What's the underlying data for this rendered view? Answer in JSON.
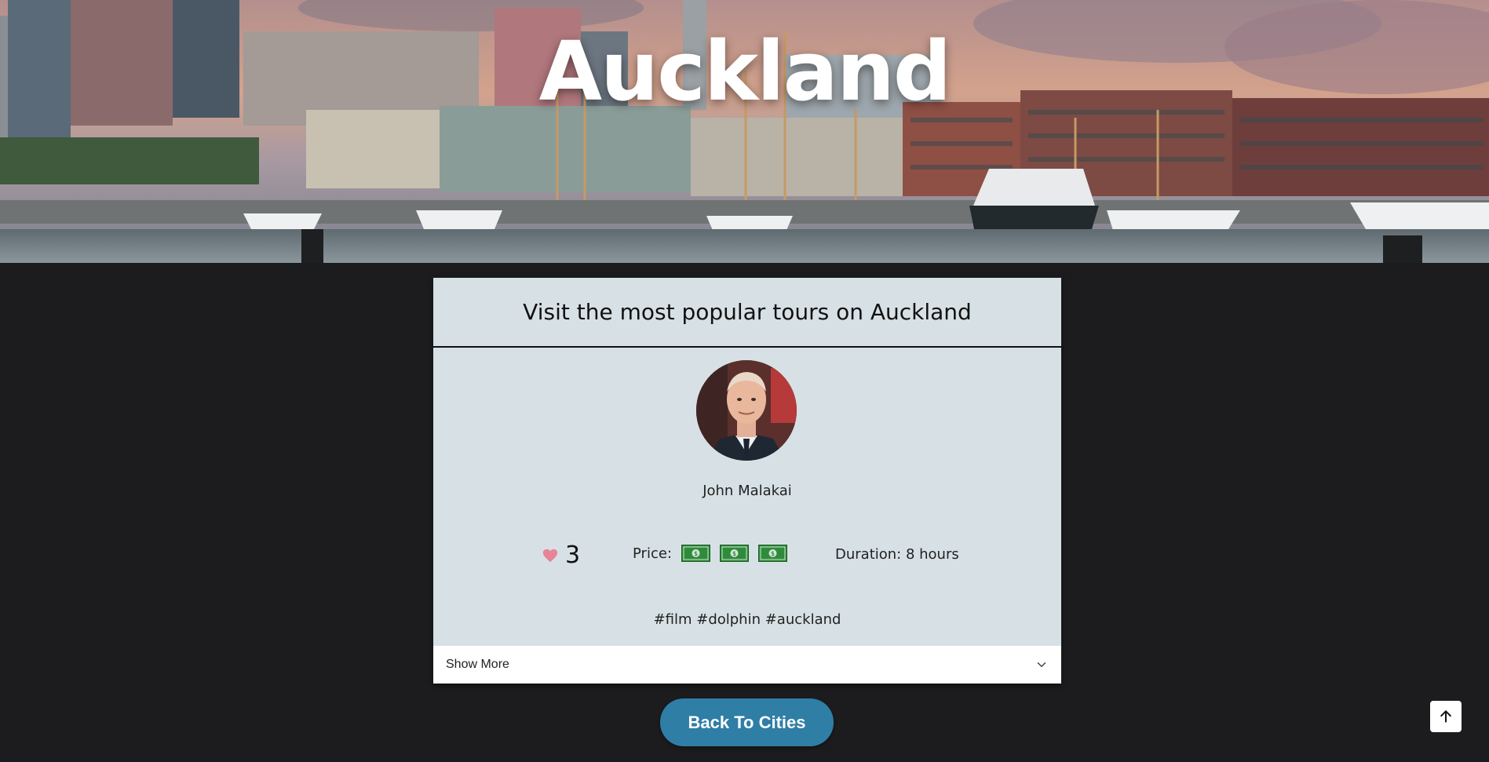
{
  "hero": {
    "title": "Auckland"
  },
  "card": {
    "heading": "Visit the most popular tours on Auckland",
    "author": "John Malakai",
    "likes": "3",
    "price_label": "Price:",
    "price_level": 3,
    "duration": "Duration: 8 hours",
    "tags": "#film #dolphin #auckland",
    "show_more": "Show More"
  },
  "buttons": {
    "back": "Back To Cities"
  },
  "colors": {
    "background": "#1c1c1e",
    "card": "#d7e1e5",
    "button": "#2e7ea6",
    "heart": "#e88497",
    "bill": "#2e8b3a"
  },
  "icons": {
    "likes": "heart-icon",
    "price": "dollar-bill-icon",
    "show_more": "chevron-down-icon",
    "scroll_top": "arrow-up-icon"
  }
}
